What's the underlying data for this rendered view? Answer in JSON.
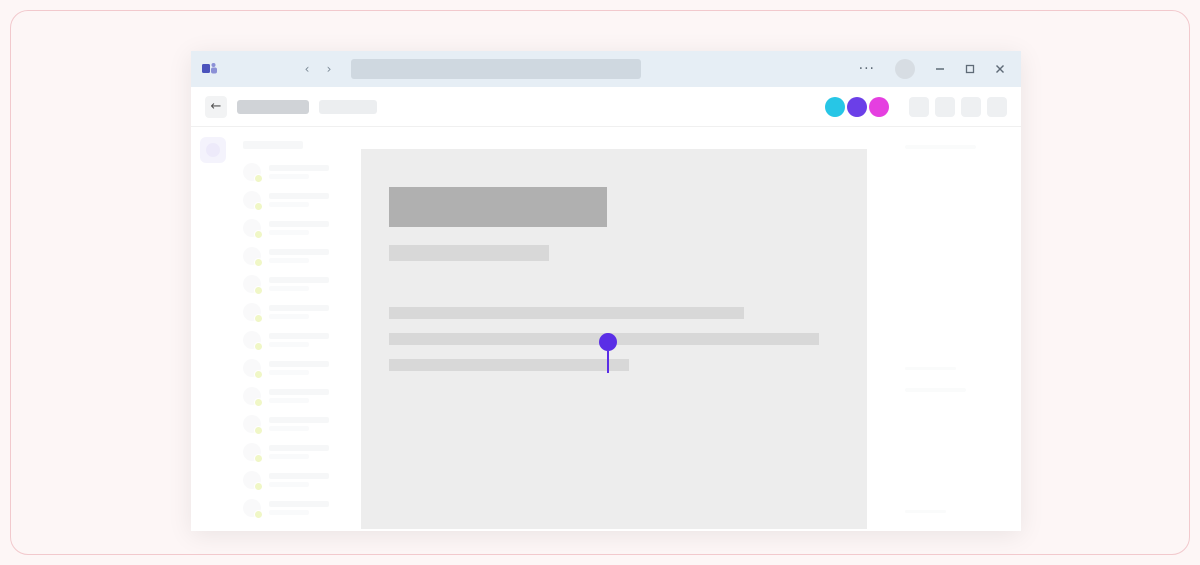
{
  "titlebar": {
    "app": "teams",
    "nav_back_glyph": "‹",
    "nav_fwd_glyph": "›",
    "more_glyph": "···",
    "search_placeholder": ""
  },
  "window_controls": {
    "minimize": "minimize",
    "maximize": "maximize",
    "close": "close"
  },
  "subheader": {
    "back_glyph": "←"
  },
  "presence_colors": {
    "cyan": "#27c6e6",
    "purple": "#6b3fe8",
    "magenta": "#e53fe0"
  },
  "cursor": {
    "color": "#5a2ee6"
  },
  "chat_list": {
    "item_count": 13
  }
}
